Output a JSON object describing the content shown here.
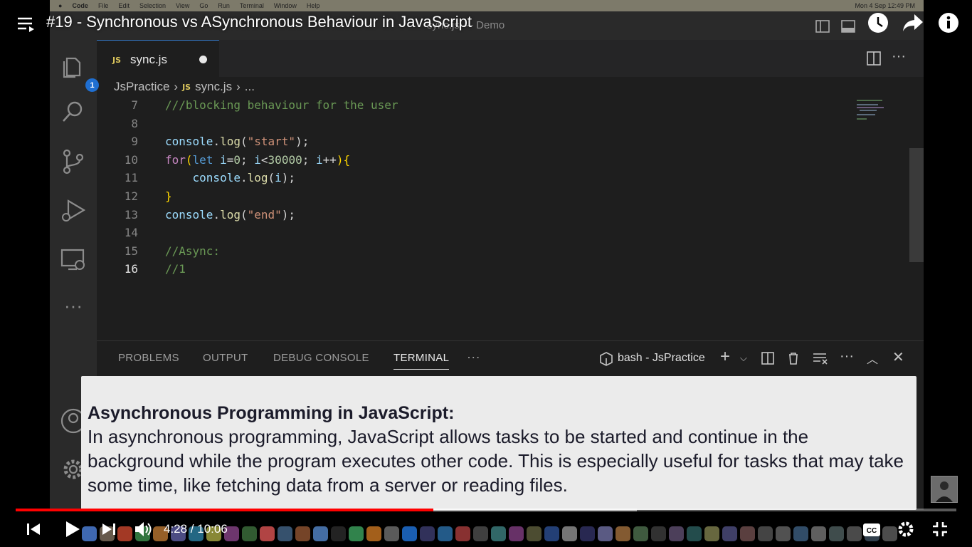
{
  "video": {
    "title": "#19 - Synchronous vs ASynchronous Behaviour in JavaScript",
    "time_current": "4:28",
    "time_total": "10:06",
    "time_display": "4:28 / 10:06",
    "progress_fraction": 0.444,
    "buffered_fraction": 0.66
  },
  "menubar": {
    "items": [
      "Code",
      "File",
      "Edit",
      "Selection",
      "View",
      "Go",
      "Run",
      "Terminal",
      "Window",
      "Help"
    ],
    "right": "Mon 4 Sep  12:49 PM"
  },
  "vscode": {
    "window_title": "sync.js — Demo",
    "explorer_badge": "1",
    "tab": {
      "icon": "JS",
      "filename": "sync.js"
    },
    "breadcrumb": {
      "folder": "JsPractice",
      "icon": "JS",
      "file": "sync.js",
      "more": "..."
    },
    "lines": [
      {
        "num": "7",
        "tokens": [
          {
            "t": "///blocking behaviour for the user",
            "c": "cmt"
          }
        ]
      },
      {
        "num": "8",
        "tokens": []
      },
      {
        "num": "9",
        "tokens": [
          {
            "t": "console",
            "c": "var"
          },
          {
            "t": ".",
            "c": "p"
          },
          {
            "t": "log",
            "c": "fn"
          },
          {
            "t": "(",
            "c": "p"
          },
          {
            "t": "\"start\"",
            "c": "str"
          },
          {
            "t": ");",
            "c": "p"
          }
        ]
      },
      {
        "num": "10",
        "tokens": [
          {
            "t": "for",
            "c": "kw"
          },
          {
            "t": "(",
            "c": "br"
          },
          {
            "t": "let ",
            "c": "let"
          },
          {
            "t": "i",
            "c": "var"
          },
          {
            "t": "=",
            "c": "p"
          },
          {
            "t": "0",
            "c": "num"
          },
          {
            "t": "; ",
            "c": "p"
          },
          {
            "t": "i",
            "c": "var"
          },
          {
            "t": "<",
            "c": "p"
          },
          {
            "t": "30000",
            "c": "num"
          },
          {
            "t": "; ",
            "c": "p"
          },
          {
            "t": "i",
            "c": "var"
          },
          {
            "t": "++",
            "c": "p"
          },
          {
            "t": "){",
            "c": "br"
          }
        ]
      },
      {
        "num": "11",
        "tokens": [
          {
            "t": "    console",
            "c": "var"
          },
          {
            "t": ".",
            "c": "p"
          },
          {
            "t": "log",
            "c": "fn"
          },
          {
            "t": "(",
            "c": "p"
          },
          {
            "t": "i",
            "c": "var"
          },
          {
            "t": ");",
            "c": "p"
          }
        ]
      },
      {
        "num": "12",
        "tokens": [
          {
            "t": "}",
            "c": "br"
          }
        ]
      },
      {
        "num": "13",
        "tokens": [
          {
            "t": "console",
            "c": "var"
          },
          {
            "t": ".",
            "c": "p"
          },
          {
            "t": "log",
            "c": "fn"
          },
          {
            "t": "(",
            "c": "p"
          },
          {
            "t": "\"end\"",
            "c": "str"
          },
          {
            "t": ");",
            "c": "p"
          }
        ]
      },
      {
        "num": "14",
        "tokens": []
      },
      {
        "num": "15",
        "tokens": [
          {
            "t": "//Async:",
            "c": "cmt"
          }
        ]
      },
      {
        "num": "16",
        "tokens": [
          {
            "t": "//1",
            "c": "cmt"
          }
        ]
      }
    ],
    "active_line": "16",
    "panel": {
      "tabs": [
        "PROBLEMS",
        "OUTPUT",
        "DEBUG CONSOLE",
        "TERMINAL"
      ],
      "active_tab": "TERMINAL",
      "more": "···",
      "terminal_name": "bash - JsPractice"
    }
  },
  "caption": {
    "title": "Asynchronous Programming in JavaScript:",
    "body": "In asynchronous programming, JavaScript allows tasks to be started and continue in the background while the program executes other code. This is especially useful for tasks that may take some time, like fetching data from a server or reading files."
  },
  "colors": {
    "progress": "#ff0000",
    "caption_bg": "#ebebeb",
    "editor_bg": "#1e1e1e"
  },
  "icons": [
    "playlist-icon",
    "watch-later-icon",
    "share-icon",
    "info-icon",
    "previous-icon",
    "play-icon",
    "next-icon",
    "volume-icon",
    "captions-icon",
    "settings-icon",
    "exit-fullscreen-icon"
  ]
}
